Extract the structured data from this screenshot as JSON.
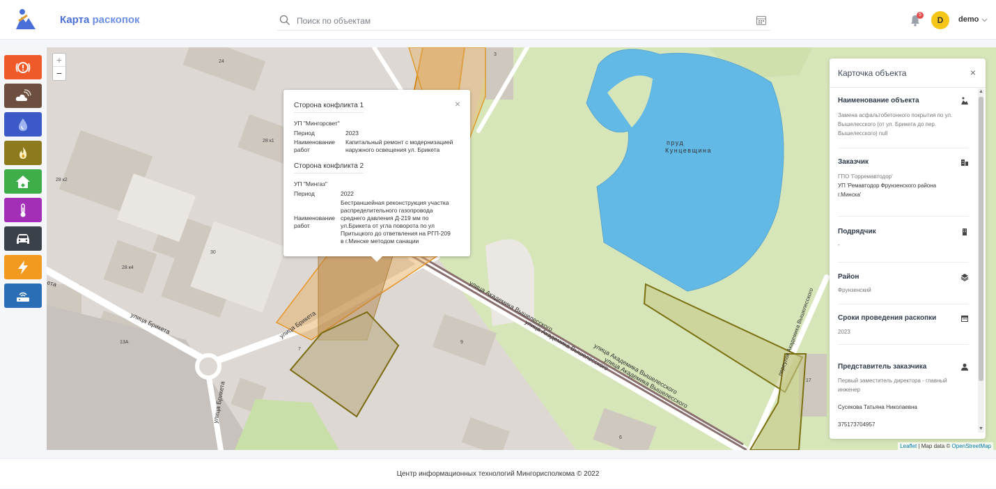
{
  "header": {
    "app_title_main": "Карта",
    "app_title_sub": "раскопок",
    "search_placeholder": "Поиск по объектам",
    "notification_count": "5",
    "avatar_letter": "D",
    "username": "demo"
  },
  "layers": [
    {
      "name": "alert",
      "icon": "alert-icon",
      "color": "#f05a28"
    },
    {
      "name": "weather",
      "icon": "cloud-signal-icon",
      "color": "#6d4f3f"
    },
    {
      "name": "water",
      "icon": "water-drop-icon",
      "color": "#3b5ac8"
    },
    {
      "name": "gas",
      "icon": "flame-icon",
      "color": "#8c7a1d"
    },
    {
      "name": "housing",
      "icon": "house-icon",
      "color": "#3fae4a"
    },
    {
      "name": "heating",
      "icon": "thermometer-icon",
      "color": "#a22fb5"
    },
    {
      "name": "transport",
      "icon": "car-icon",
      "color": "#3b4148"
    },
    {
      "name": "power",
      "icon": "lightning-icon",
      "color": "#f29a1f"
    },
    {
      "name": "telecom",
      "icon": "router-icon",
      "color": "#2a6fb5"
    }
  ],
  "map": {
    "zoom_in": "+",
    "zoom_out": "−",
    "attribution_leaflet": "Leaflet",
    "attribution_sep": "| Map data ©",
    "attribution_osm": "OpenStreetMap",
    "labels": {
      "pond_1": "пруд",
      "pond_2": "Кунцевщина",
      "street_akademika_1": "улица Академика Вышелесского",
      "street_akademika_2": "улица Академика Вышелесского",
      "street_akademika_3": "улица Академика Вышелесского",
      "street_akademika_4": "улица Академика Вышелесского",
      "street_briketa_1": "улица Брикета",
      "street_briketa_2": "улица Брикета",
      "street_briketa_3": "улица Брикета",
      "street_eta": "ета",
      "lane": "переулок Академика Вышелесского",
      "b24": "24",
      "b28k1": "28 к1",
      "b28k2": "28 к2",
      "b30": "30",
      "b28k4": "28 к4",
      "b13a": "13А",
      "b7": "7",
      "b9": "9",
      "b3": "3",
      "b17": "17",
      "b6": "6"
    }
  },
  "popup": {
    "close": "×",
    "side1_title": "Сторона конфликта 1",
    "side1_org": "УП \"Мингорсвет\"",
    "side1_period_label": "Период",
    "side1_period": "2023",
    "side1_works_label_1": "Наименование",
    "side1_works_label_2": "работ",
    "side1_works_1": "Капитальный ремонт с модернизацией",
    "side1_works_2": "наружного освещения ул. Брикета",
    "side2_title": "Сторона конфликта 2",
    "side2_org": "УП \"Мингаз\"",
    "side2_period_label": "Период",
    "side2_period": "2022",
    "side2_works_label_1": "Наименование",
    "side2_works_label_2": "работ",
    "side2_works_lines": [
      "Бестраншейная реконструкция участка",
      "распределительного газопровода",
      "среднего давления Д-219 мм по",
      "ул.Брикета от угла поворота по ул",
      "Притыцкого до ответвления на РГП-209",
      "в г.Минске методом санации"
    ]
  },
  "card": {
    "title": "Карточка объекта",
    "close": "×",
    "object_label": "Наименование объекта",
    "object_lines": [
      "Замена асфальтобетонного покрытия по ул.",
      "Вышелесского (от ул. Брикета до пер.",
      "Вышелесского) null"
    ],
    "customer_label": "Заказчик",
    "customer_1": "ГПО 'Горремавтодор'",
    "customer_2_lines": [
      "УП 'Ремавтодор Фрунзенского района",
      "г.Минска'"
    ],
    "contractor_label": "Подрядчик",
    "contractor": "-",
    "district_label": "Район",
    "district": "Фрунзенский",
    "dates_label": "Сроки проведения раскопки",
    "dates": "2023",
    "rep_label": "Представитель заказчика",
    "rep_position_lines": [
      "Первый заместитель директора - главный",
      "инженер"
    ],
    "rep_name": "Сусекова Татьяна Николаевна",
    "rep_phone": "375173704957"
  },
  "footer": {
    "text": "Центр информационных технологий Мингорисполкома © 2022"
  }
}
